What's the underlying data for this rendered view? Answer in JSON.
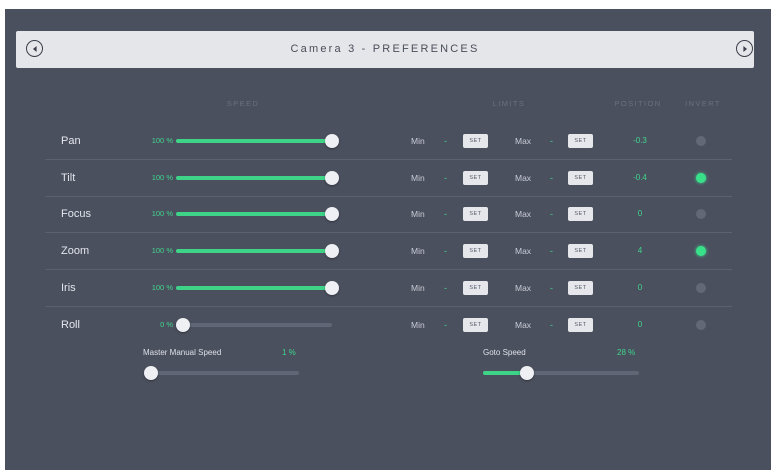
{
  "header": {
    "title": "Camera 3 - PREFERENCES",
    "prev_icon": "chevron-left-circle",
    "next_icon": "chevron-right-circle"
  },
  "columns": {
    "speed": "SPEED",
    "limits": "LIMITS",
    "position": "POSITION",
    "invert": "INVERT"
  },
  "labels": {
    "min": "Min",
    "max": "Max",
    "dash": "-",
    "set": "SET"
  },
  "axes": [
    {
      "name": "Pan",
      "speed_text": "100 %",
      "speed": 1.0,
      "position": "-0.3",
      "invert": false
    },
    {
      "name": "Tilt",
      "speed_text": "100 %",
      "speed": 1.0,
      "position": "-0.4",
      "invert": true
    },
    {
      "name": "Focus",
      "speed_text": "100 %",
      "speed": 1.0,
      "position": "0",
      "invert": false
    },
    {
      "name": "Zoom",
      "speed_text": "100 %",
      "speed": 1.0,
      "position": "4",
      "invert": true
    },
    {
      "name": "Iris",
      "speed_text": "100 %",
      "speed": 1.0,
      "position": "0",
      "invert": false
    },
    {
      "name": "Roll",
      "speed_text": "0 %",
      "speed": 0.0,
      "position": "0",
      "invert": false
    }
  ],
  "master_manual_speed": {
    "label": "Master Manual Speed",
    "value_text": "1 %",
    "value": 0.01
  },
  "goto_speed": {
    "label": "Goto Speed",
    "value_text": "28 %",
    "value": 0.28
  },
  "colors": {
    "panel": "#4b505f",
    "accent": "#3ed488",
    "header": "#e4e6ea"
  }
}
